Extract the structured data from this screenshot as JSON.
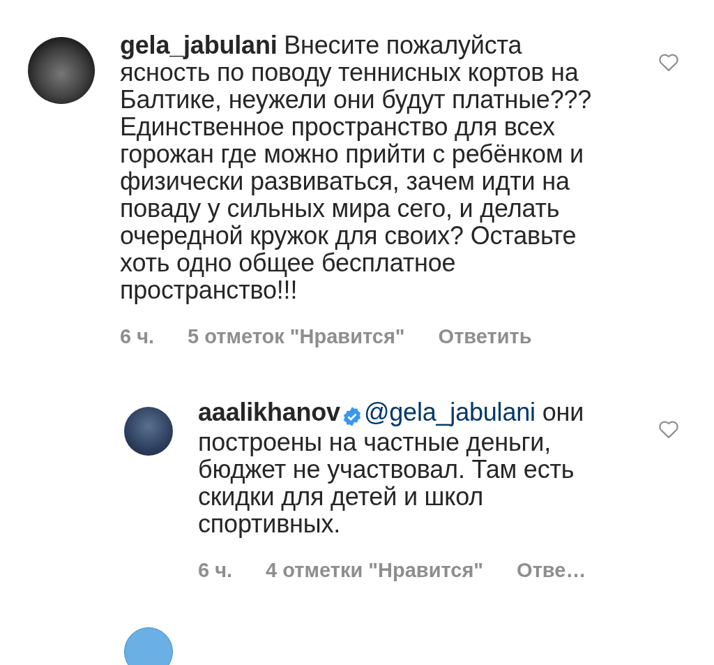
{
  "comments": [
    {
      "username": "gela_jabulani",
      "verified": false,
      "text": "Внесите пожалуйста ясность по поводу теннисных кортов на Балтике,  неужели они будут платные??? Единственное пространство для всех горожан где можно прийти с ребёнком и физически развиваться, зачем идти на поваду у сильных мира сего, и делать очередной кружок для своих? Оставьте хоть одно общее бесплатное пространство!!!",
      "time": "6 ч.",
      "likes": "5 отметок \"Нравится\"",
      "reply": "Ответить",
      "is_reply": false
    },
    {
      "username": "aaalikhanov",
      "verified": true,
      "mention": "@gela_jabulani",
      "text": "они построены на частные деньги, бюджет не участвовал. Там есть скидки для детей и школ спортивных.",
      "time": "6 ч.",
      "likes": "4 отметки \"Нравится\"",
      "reply": "Отве…",
      "is_reply": true
    }
  ],
  "next_comment": {
    "is_reply": true
  }
}
